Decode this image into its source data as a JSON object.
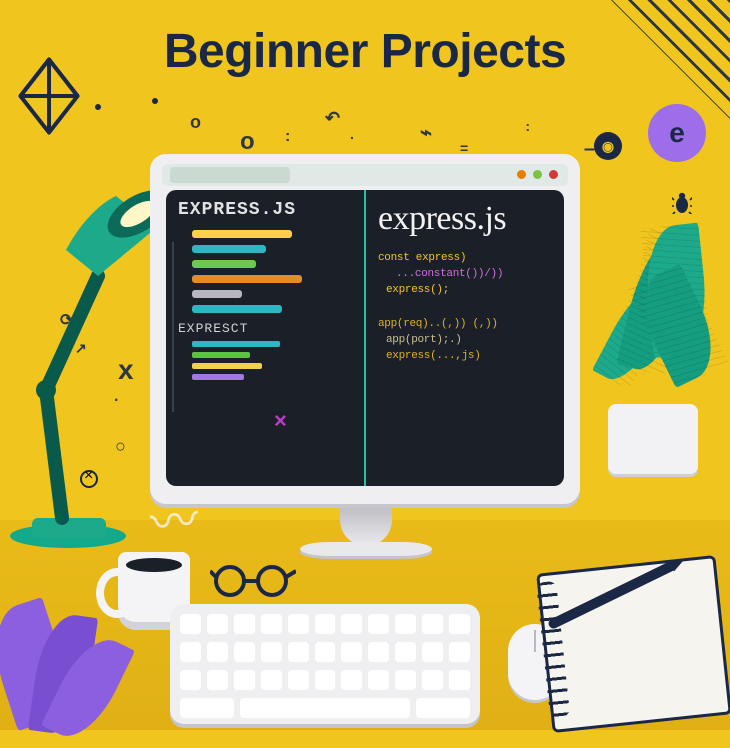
{
  "title": "Beginner Projects",
  "screen": {
    "left_label": "EXPRESS.JS",
    "sub_label": "EXPRESCT",
    "right_label": "express.js",
    "code_lines": [
      "const express)",
      "...constant())/))",
      "express();",
      "app(req)..(,)) (,))",
      "app(port);.)",
      "express(...,js)"
    ]
  },
  "badge_letter": "e",
  "colors": {
    "bg": "#efc51e",
    "navy": "#1a2846",
    "teal": "#1daa8b",
    "purple": "#9d6dea",
    "screen": "#1b2028"
  }
}
